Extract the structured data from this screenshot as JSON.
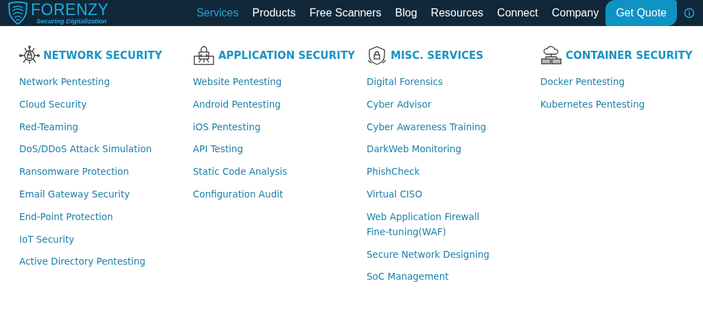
{
  "logo": {
    "name": "FORENZY",
    "tagline": "Securing Digitalization"
  },
  "nav": [
    {
      "label": "Services",
      "selected": true
    },
    {
      "label": "Products",
      "selected": false
    },
    {
      "label": "Free Scanners",
      "selected": false
    },
    {
      "label": "Blog",
      "selected": false
    },
    {
      "label": "Resources",
      "selected": false
    },
    {
      "label": "Connect",
      "selected": false
    },
    {
      "label": "Company",
      "selected": false
    }
  ],
  "cta": "Get Quote",
  "columns": [
    {
      "kind": "network",
      "title": "NETWORK SECURITY",
      "items": [
        "Network Pentesting",
        "Cloud Security",
        "Red-Teaming",
        "DoS/DDoS Attack Simulation",
        "Ransomware Protection",
        "Email Gateway Security",
        "End-Point Protection",
        "IoT Security",
        "Active Directory Pentesting"
      ]
    },
    {
      "kind": "application",
      "title": "APPLICATION SECURITY",
      "items": [
        "Website Pentesting",
        "Android Pentesting",
        "iOS Pentesting",
        "API Testing",
        "Static Code Analysis",
        "Configuration Audit"
      ]
    },
    {
      "kind": "misc",
      "title": "MISC. SERVICES",
      "items": [
        "Digital Forensics",
        "Cyber Advisor",
        "Cyber Awareness Training",
        "DarkWeb Monitoring",
        "PhishCheck",
        "Virtual CISO",
        "Web Application Firewall Fine-tuning(WAF)",
        "Secure Network Designing",
        "SoC Management"
      ]
    },
    {
      "kind": "container",
      "title": "CONTAINER SECURITY",
      "items": [
        "Docker Pentesting",
        "Kubernetes Pentesting"
      ]
    }
  ]
}
